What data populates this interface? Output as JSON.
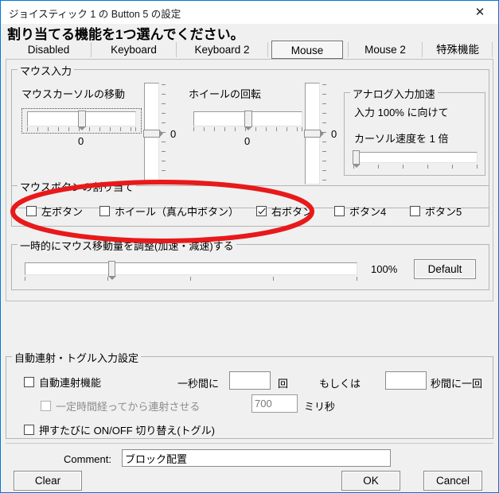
{
  "window": {
    "title": "ジョイスティック 1 の Button 5 の設定",
    "close_icon": "close-icon",
    "close_glyph": "✕",
    "accent_color": "#0078d7"
  },
  "headline": "割り当てる機能を1つ選んでください。",
  "tabs": [
    {
      "label": "Disabled",
      "selected": false
    },
    {
      "label": "Keyboard",
      "selected": false
    },
    {
      "label": "Keyboard 2",
      "selected": false
    },
    {
      "label": "Mouse",
      "selected": true
    },
    {
      "label": "Mouse 2",
      "selected": false
    },
    {
      "label": "特殊機能",
      "selected": false
    }
  ],
  "mouse_input": {
    "legend": "マウス入力",
    "cursor_move": {
      "label": "マウスカーソルの移動",
      "x_value": "0",
      "y_value": "0"
    },
    "wheel": {
      "label": "ホイールの回転",
      "x_value": "0",
      "y_value": "0"
    },
    "analog_accel": {
      "legend": "アナログ入力加速",
      "line1": "入力 100% に向けて",
      "line2": "カーソル速度を 1  倍"
    }
  },
  "mouse_buttons": {
    "legend": "マウスボタンの割り当て",
    "items": [
      {
        "label": "左ボタン",
        "checked": false
      },
      {
        "label": "ホイール（真ん中ボタン）",
        "checked": false
      },
      {
        "label": "右ボタン",
        "checked": true
      },
      {
        "label": "ボタン4",
        "checked": false
      },
      {
        "label": "ボタン5",
        "checked": false
      }
    ]
  },
  "temp_adjust": {
    "legend": "一時的にマウス移動量を調整(加速・減速)する",
    "percent": "100%",
    "default_button": "Default"
  },
  "autofire": {
    "legend": "自動連射・トグル入力設定",
    "enable_label": "自動連射機能",
    "enable_checked": false,
    "rate_prefix": "一秒間に",
    "rate_value": "",
    "rate_suffix": "回",
    "or_label": "もしくは",
    "interval_value": "",
    "interval_suffix": "秒間に一回",
    "delay_label": "一定時間経ってから連射させる",
    "delay_checked": false,
    "delay_value": "700",
    "delay_unit": "ミリ秒",
    "toggle_label": "押すたびに ON/OFF 切り替え(トグル)",
    "toggle_checked": false
  },
  "footer": {
    "comment_label": "Comment:",
    "comment_value": "ブロック配置",
    "comment_placeholder": "",
    "clear_button": "Clear",
    "ok_button": "OK",
    "cancel_button": "Cancel"
  },
  "annotation": {
    "shape": "red-ellipse-highlight",
    "color": "#e8191b",
    "targets": "mouse-buttons-row"
  }
}
